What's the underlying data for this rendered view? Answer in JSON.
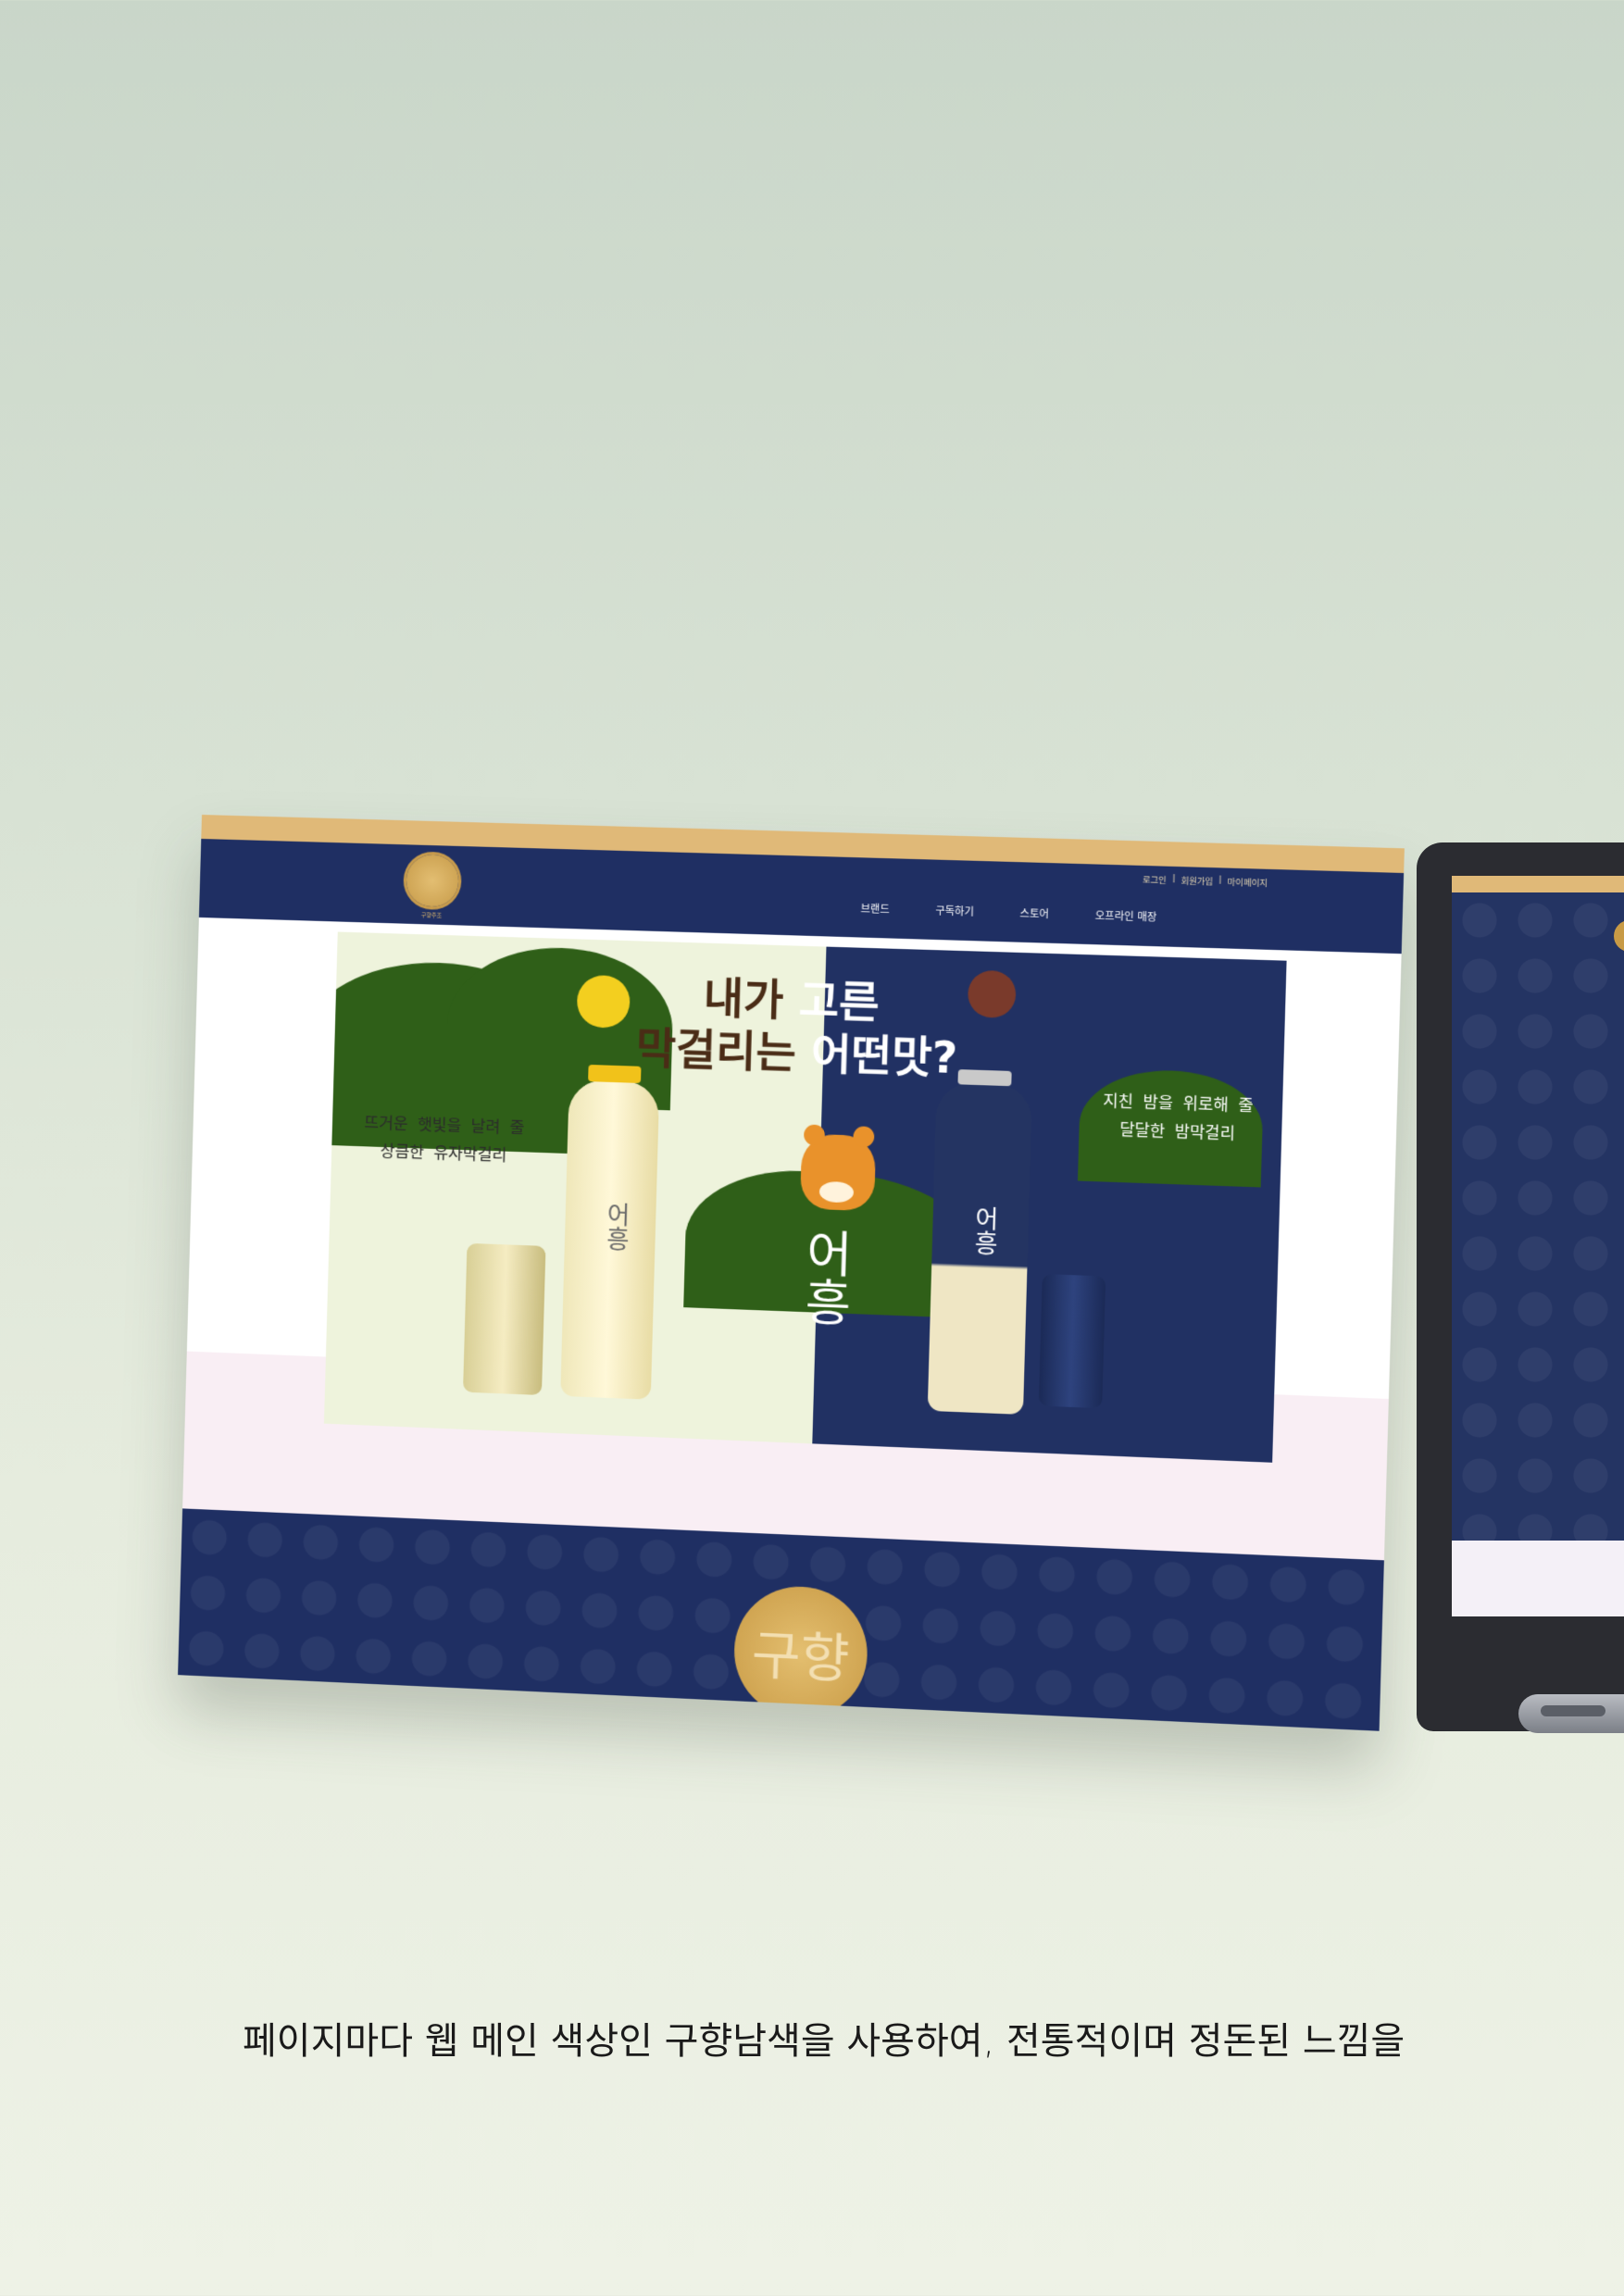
{
  "header": {
    "util_links": [
      "로그인",
      "회원가입",
      "마이페이지"
    ],
    "util_separator": "|",
    "nav": [
      "브랜드",
      "구독하기",
      "스토어",
      "오프라인 매장"
    ],
    "logo_caption": "구향주조"
  },
  "hero": {
    "headline_line1_dark": "내가",
    "headline_line1_light": "고른",
    "headline_line2_dark": "막걸리는",
    "headline_line2_light": "어떤맛?",
    "yuja_tagline_line1": "뜨거운 햇빛을 날려 줄",
    "yuja_tagline_line2": "상큼한 유자막걸리",
    "bam_tagline_line1": "지친 밤을 위로해 줄",
    "bam_tagline_line2": "달달한 밤막걸리",
    "brand_name": "어흥",
    "bottle_label_yuja": "어흥",
    "bottle_label_bam": "어흥"
  },
  "footer": {
    "logo_glyph": "구향"
  },
  "caption": {
    "text": "페이지마다 웹 메인 색상인 구향남색을 사용하여, 전통적이며 정돈된 느낌을"
  },
  "colors": {
    "navy": "#1f2f63",
    "gold": "#e0b978",
    "cream": "#eef3dc",
    "hill_green": "#2f5f18",
    "tiger_orange": "#e9922b",
    "pink": "#f9eef4"
  },
  "icons": {
    "logo": "brand-emblem-icon",
    "lemon": "yuja-fruit-icon",
    "chestnut": "chestnut-icon"
  }
}
